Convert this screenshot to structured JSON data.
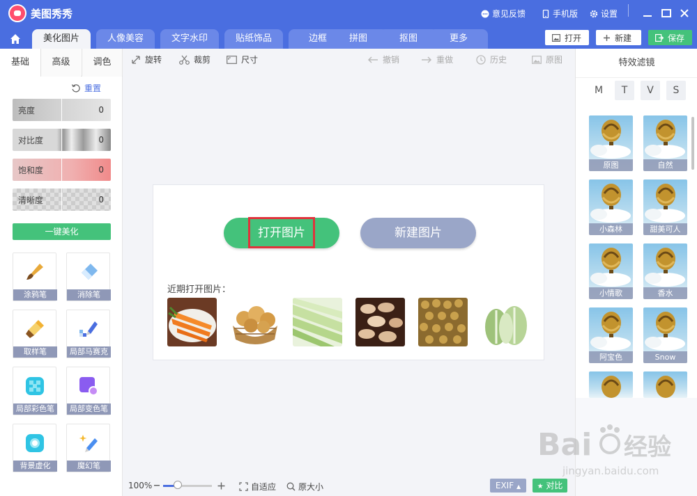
{
  "app": {
    "title": "美图秀秀",
    "feedback": "意见反馈",
    "mobile": "手机版",
    "settings": "设置"
  },
  "tabs": [
    {
      "label": "美化图片",
      "active": true
    },
    {
      "label": "人像美容"
    },
    {
      "label": "文字水印"
    },
    {
      "label": "贴纸饰品"
    },
    {
      "label": "边框"
    },
    {
      "label": "拼图"
    },
    {
      "label": "抠图"
    },
    {
      "label": "更多"
    }
  ],
  "header_buttons": {
    "open": "打开",
    "new": "新建",
    "save": "保存"
  },
  "left": {
    "subtabs": [
      "基础",
      "高级",
      "调色"
    ],
    "reset": "重置",
    "sliders": [
      {
        "label": "亮度",
        "value": "0"
      },
      {
        "label": "对比度",
        "value": "0"
      },
      {
        "label": "饱和度",
        "value": "0"
      },
      {
        "label": "清晰度",
        "value": "0"
      }
    ],
    "one_key": "一键美化",
    "tools": [
      "涂鸦笔",
      "消除笔",
      "取样笔",
      "局部马赛克",
      "局部彩色笔",
      "局部变色笔",
      "背景虚化",
      "魔幻笔"
    ]
  },
  "toolbar": {
    "rotate": "旋转",
    "crop": "裁剪",
    "size": "尺寸",
    "undo": "撤销",
    "redo": "重做",
    "history": "历史",
    "original": "原图"
  },
  "canvas": {
    "open_image": "打开图片",
    "new_image": "新建图片",
    "recent_label": "近期打开图片："
  },
  "status": {
    "zoom": "100%",
    "zoom_level": 0.3,
    "fit": "自适应",
    "actual_size": "原大小",
    "exif": "EXIF",
    "compare": "对比"
  },
  "right": {
    "title": "特效滤镜",
    "letters": [
      "M",
      "T",
      "V",
      "S"
    ],
    "filters": [
      "原图",
      "自然",
      "小森林",
      "甜美可人",
      "小情歌",
      "香水",
      "阿宝色",
      "Snow"
    ]
  },
  "colors": {
    "primary": "#4a6ee0",
    "green": "#44c27b",
    "highlight": "#e0333c"
  }
}
